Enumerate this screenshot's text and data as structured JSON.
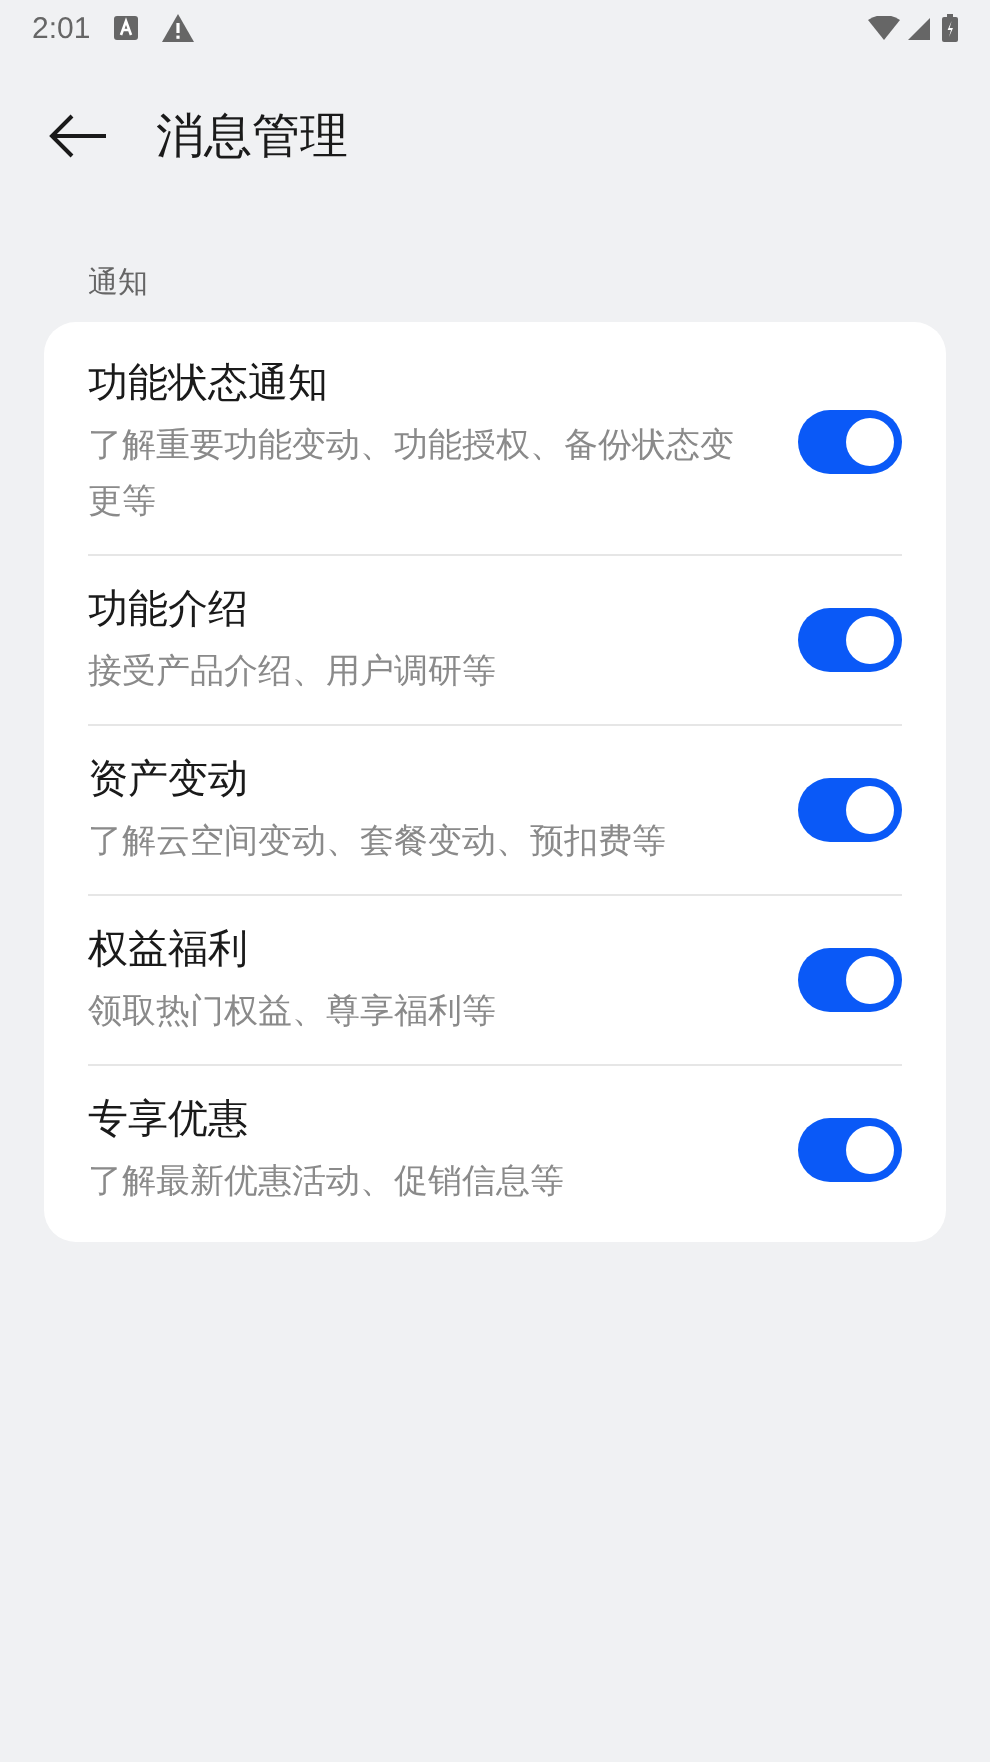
{
  "status_bar": {
    "time": "2:01"
  },
  "header": {
    "title": "消息管理"
  },
  "section": {
    "label": "通知"
  },
  "settings": [
    {
      "title": "功能状态通知",
      "description": "了解重要功能变动、功能授权、备份状态变更等",
      "on": true
    },
    {
      "title": "功能介绍",
      "description": "接受产品介绍、用户调研等",
      "on": true
    },
    {
      "title": "资产变动",
      "description": "了解云空间变动、套餐变动、预扣费等",
      "on": true
    },
    {
      "title": "权益福利",
      "description": "领取热门权益、尊享福利等",
      "on": true
    },
    {
      "title": "专享优惠",
      "description": "了解最新优惠活动、促销信息等",
      "on": true
    }
  ]
}
